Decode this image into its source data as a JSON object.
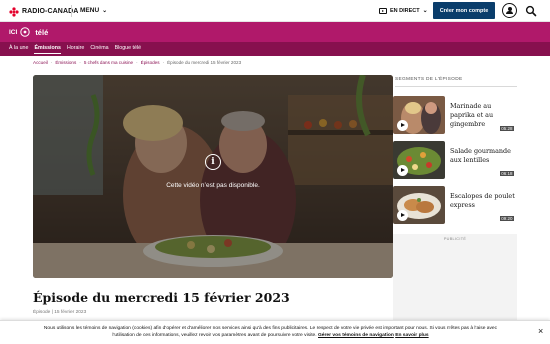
{
  "topbar": {
    "brand": "RADIO-CANADA",
    "menu_label": "MENU",
    "live_label": "EN DIRECT",
    "create_account": "Créer mon compte"
  },
  "section": {
    "ici": "ICI",
    "tele": "télé"
  },
  "subnav": {
    "items": [
      "À la une",
      "Émissions",
      "Horaire",
      "Cinéma",
      "Blogue télé"
    ],
    "active_index": 1
  },
  "breadcrumb": [
    "Accueil",
    "Émissions",
    "5 chefs dans ma cuisine",
    "Épisodes",
    "Épisode du mercredi 15 février 2023"
  ],
  "video": {
    "message": "Cette vidéo n’est pas disponible."
  },
  "episode": {
    "title": "Épisode du mercredi 15 février 2023",
    "meta": "Épisode | 15 février 2023"
  },
  "sidebar": {
    "heading": "SEGMENTS DE L'ÉPISODE",
    "segments": [
      {
        "title": "Marinade au paprika et au gingembre",
        "duration": "05:28"
      },
      {
        "title": "Salade gourmande aux lentilles",
        "duration": "06:18"
      },
      {
        "title": "Escalopes de poulet express",
        "duration": "09:20"
      }
    ],
    "ad_label": "PUBLICITÉ"
  },
  "cookie": {
    "line1": "Nous utilisons les témoins de navigation (cookies) afin d'opérer et d'améliorer nos services ainsi qu'à des fins publicitaires. Le respect de votre vie privée est important pour nous. Si vous n'êtes pas à l'aise avec",
    "line2": "l'utilisation de ces informations, veuillez revoir vos paramètres avant de poursuivre votre visite.",
    "link1": "Gérer vos témoins de navigation",
    "link2": "En savoir plus",
    "close": "×"
  },
  "colors": {
    "magenta": "#b0196a",
    "magenta_dark": "#87104e",
    "navy": "#0a3d6b"
  }
}
